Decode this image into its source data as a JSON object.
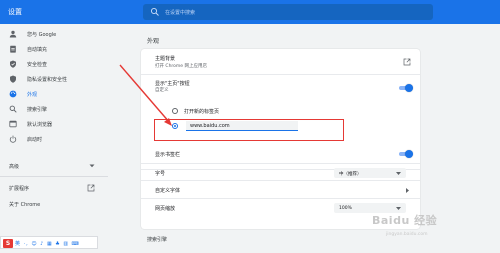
{
  "header": {
    "title": "设置",
    "search_placeholder": "在设置中搜索"
  },
  "sidebar": {
    "items": [
      {
        "label": "您与 Google",
        "icon": "person-icon"
      },
      {
        "label": "自动填充",
        "icon": "clipboard-icon"
      },
      {
        "label": "安全检查",
        "icon": "shield-icon"
      },
      {
        "label": "隐私设置和安全性",
        "icon": "shield-lock-icon"
      },
      {
        "label": "外观",
        "icon": "palette-icon",
        "active": true
      },
      {
        "label": "搜索引擎",
        "icon": "search-icon"
      },
      {
        "label": "默认浏览器",
        "icon": "browser-icon"
      },
      {
        "label": "启动时",
        "icon": "power-icon"
      }
    ],
    "advanced": "高级",
    "extensions": "扩展程序",
    "about": "关于 Chrome"
  },
  "main": {
    "section_title": "外观",
    "theme": {
      "title": "主题背景",
      "subtitle": "打开 Chrome 网上应用店"
    },
    "home_button": {
      "title": "显示\"主页\"按钮",
      "subtitle": "自定义",
      "enabled": true
    },
    "home_options": {
      "new_tab_label": "打开新的标签页",
      "custom_url": "www.baidu.com",
      "selected": "custom"
    },
    "bookmarks_bar": {
      "title": "显示书签栏",
      "enabled": true
    },
    "font_size": {
      "title": "字号",
      "value": "中（推荐）"
    },
    "custom_fonts": {
      "title": "自定义字体"
    },
    "page_zoom": {
      "title": "网页缩放",
      "value": "100%"
    },
    "next_section_title": "搜索引擎"
  },
  "overlay": {
    "watermark": "Baidu 经验",
    "watermark_sub": "jingyan.baidu.com",
    "ime_label": "S",
    "ime_icons": "英 ·, ☺ ♪ ▦ ♣ ▥ ⌨",
    "annotation_color": "#e53935"
  },
  "colors": {
    "accent": "#1a73e8",
    "header": "#1a73e8"
  }
}
